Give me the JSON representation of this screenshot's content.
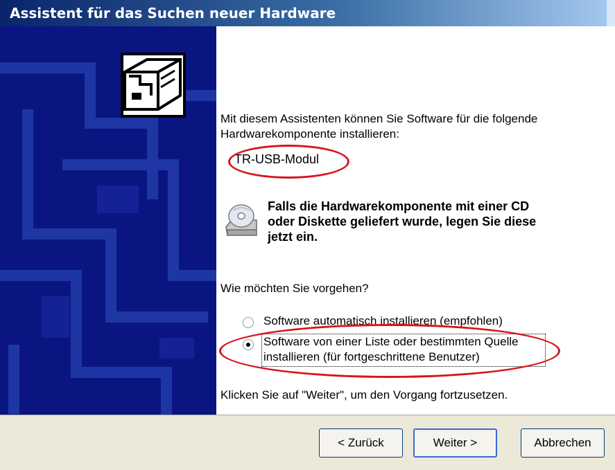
{
  "window": {
    "title": "Assistent für das Suchen neuer Hardware"
  },
  "content": {
    "intro_line1": "Mit diesem Assistenten können Sie Software für die folgende",
    "intro_line2": "Hardwarekomponente installieren:",
    "device_name": "TR-USB-Modul",
    "cd_line1": "Falls die Hardwarekomponente mit einer CD",
    "cd_line2": "oder Diskette geliefert wurde, legen Sie diese",
    "cd_line3": "jetzt ein.",
    "question": "Wie möchten Sie vorgehen?",
    "options": [
      {
        "label": "Software automatisch installieren (empfohlen)",
        "checked": false
      },
      {
        "label_line1": "Software von einer Liste oder bestimmten Quelle",
        "label_line2": "installieren (für fortgeschrittene Benutzer)",
        "checked": true
      }
    ],
    "footer_hint": "Klicken Sie auf \"Weiter\", um den Vorgang fortzusetzen."
  },
  "buttons": {
    "back": "< Zurück",
    "next": "Weiter >",
    "cancel": "Abbrechen"
  },
  "colors": {
    "left_panel": "#0b1582",
    "annotation_red": "#d8141d",
    "bottom_bar": "#ece9d8"
  },
  "icons": [
    "hardware-box-icon",
    "cd-drive-icon"
  ]
}
